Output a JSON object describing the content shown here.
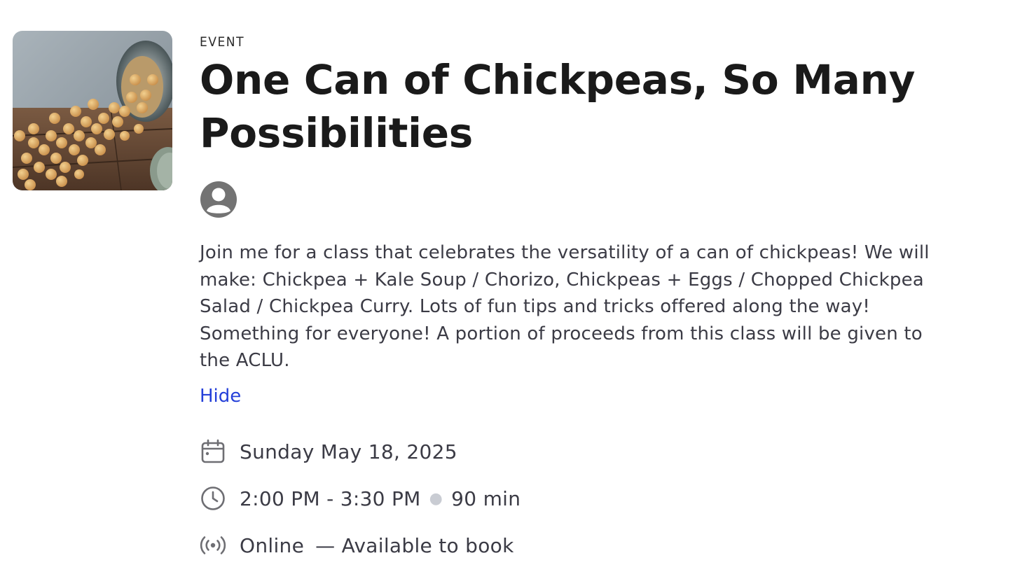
{
  "event": {
    "eyebrow": "EVENT",
    "title_line1": "One Can of Chickpeas, So Many",
    "title_line2": "Possibilities",
    "description_lines": [
      "Join me for a class that celebrates the versatility of a can of chickpeas! We will",
      "make: Chickpea + Kale Soup / Chorizo, Chickpeas + Eggs / Chopped Chickpea",
      "Salad / Chickpea Curry. Lots of fun tips and tricks offered along the way!",
      "Something for everyone! A portion of proceeds from this class will be given to",
      "the ACLU."
    ],
    "hide_label": "Hide",
    "date": "Sunday May 18, 2025",
    "time_range": "2:00 PM - 3:30 PM",
    "duration": "90 min",
    "location": "Online",
    "availability": "— Available to book"
  },
  "icons": {
    "avatar": "user-avatar-icon",
    "calendar": "calendar-icon",
    "clock": "clock-icon",
    "online": "broadcast-icon"
  },
  "colors": {
    "link": "#2540d9",
    "text": "#3b3b45",
    "heading": "#1a1a1a",
    "icon": "#6e6e73",
    "separator": "#c9ccd3"
  }
}
